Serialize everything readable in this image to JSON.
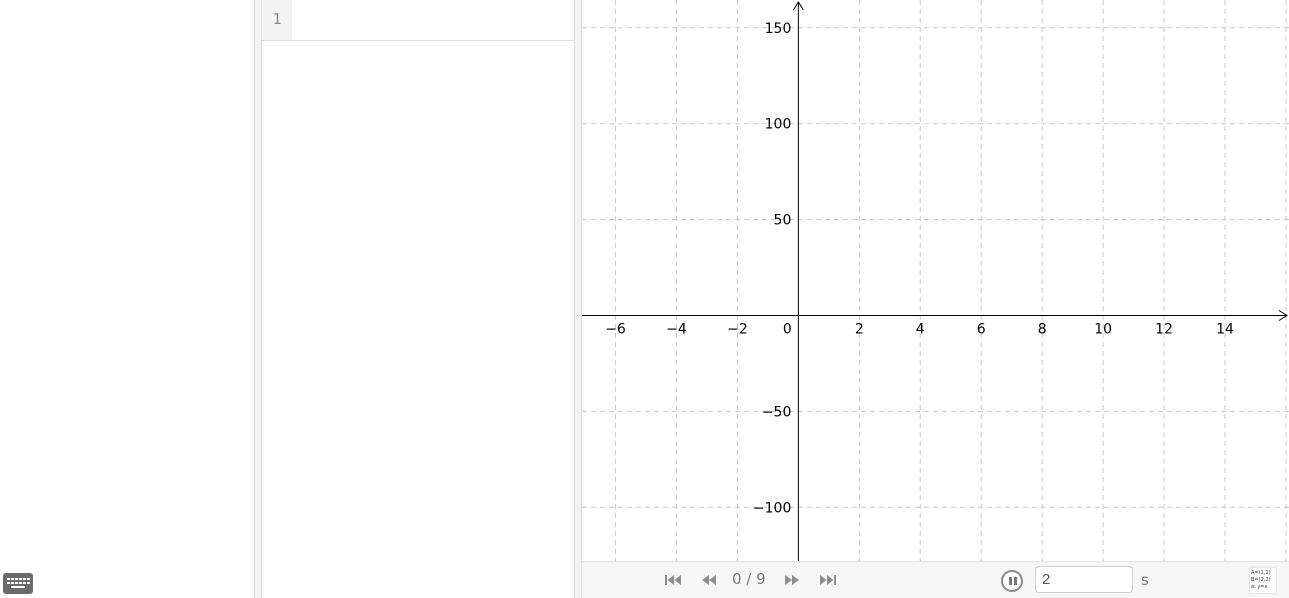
{
  "algebra": {
    "rows": [
      {
        "number": "1",
        "input": ""
      }
    ]
  },
  "graphics": {
    "x_axis": {
      "min": -7.1,
      "max": 16.1,
      "step": 2,
      "ticks": [
        "−6",
        "−4",
        "−2",
        "0",
        "2",
        "4",
        "6",
        "8",
        "10",
        "12",
        "14"
      ]
    },
    "y_axis": {
      "min": -128,
      "max": 164.5,
      "step": 50,
      "ticks": [
        "150",
        "100",
        "50",
        "−50",
        "−100"
      ]
    },
    "origin_label": "0",
    "grid": true,
    "grid_style": "dashed",
    "axis_color": "#000000",
    "grid_color": "#c8c8c8"
  },
  "toolbar": {
    "counter": "0 / 9",
    "speed_value": "2",
    "speed_unit": "s",
    "buttons": [
      "first-step-icon",
      "previous-step-icon",
      "next-step-icon",
      "last-step-icon",
      "pause-icon"
    ]
  },
  "algebra_view_icon": {
    "lines": [
      "A=(1,1)",
      "B=(2,2)",
      "a: y=x"
    ]
  },
  "keyboard_icon": "keyboard-icon"
}
